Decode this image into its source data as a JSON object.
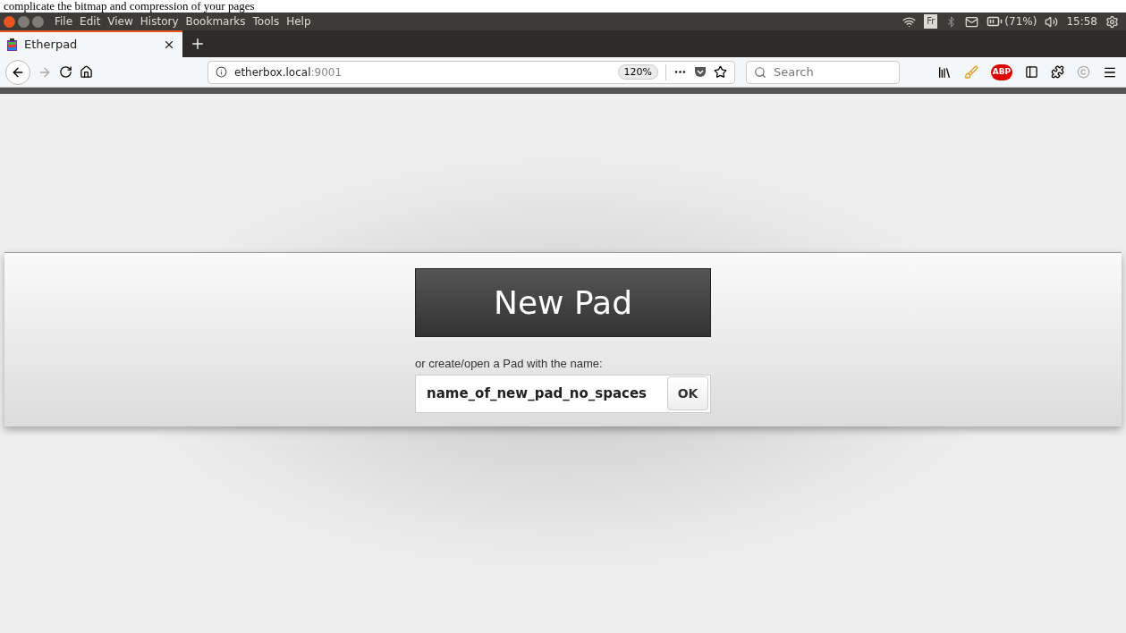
{
  "document_text": "complicate the bitmap and compression of your pages",
  "menu_bar": {
    "items": [
      "File",
      "Edit",
      "View",
      "History",
      "Bookmarks",
      "Tools",
      "Help"
    ],
    "keyboard_layout": "Fr",
    "battery": "(71%)",
    "time": "15:58"
  },
  "tabs": [
    {
      "title": "Etherpad",
      "selected": true
    }
  ],
  "toolbar": {
    "url_host": "etherbox.local",
    "url_port": ":9001",
    "zoom": "120%",
    "search_placeholder": "Search",
    "adblock_label": "ABP"
  },
  "page": {
    "new_pad_button": "New Pad",
    "prompt": "or create/open a Pad with the name:",
    "pad_name_value": "name_of_new_pad_no_spaces",
    "ok_button": "OK"
  }
}
